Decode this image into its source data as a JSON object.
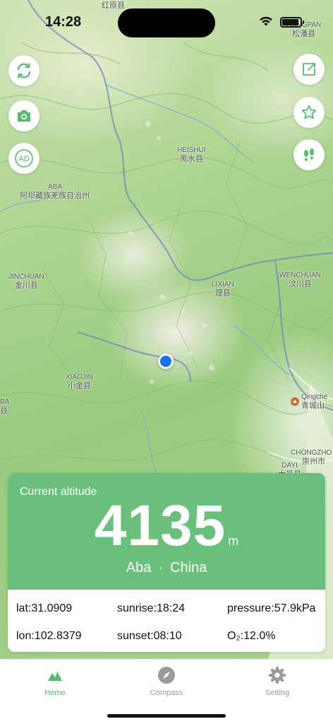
{
  "status_bar": {
    "time": "14:28"
  },
  "map": {
    "labels": {
      "hongyuan": {
        "cn": "红原县"
      },
      "songpan": {
        "en": "SONGPAN",
        "cn": "松潘县"
      },
      "heishui": {
        "en": "HEISHUI",
        "cn": "黑水县"
      },
      "aba_pref": {
        "en": "ABA",
        "cn": "阿坝藏族羌族自治州"
      },
      "jinchuan": {
        "en": "JINCHUAN",
        "cn": "金川县"
      },
      "lixian": {
        "en": "LIXIAN",
        "cn": "理县"
      },
      "wenchuan": {
        "en": "WENCHUAN",
        "cn": "汶川县"
      },
      "xiaojin": {
        "en": "XIAOJIN",
        "cn": "小金县"
      },
      "aba_edge": {
        "en": "BA",
        "cn": "县"
      },
      "qingcheng": {
        "en": "Qingche",
        "cn": "青城山"
      },
      "chongzhou": {
        "en": "CHONGZHO",
        "cn": "崇州市"
      },
      "dayi": {
        "en": "DAYI",
        "cn": "大邑县"
      }
    }
  },
  "buttons": {
    "refresh": "refresh-icon",
    "camera": "camera-icon",
    "ad": "AD",
    "share": "share-icon",
    "favorite": "star-icon",
    "footprints": "footprints-icon"
  },
  "altitude_card": {
    "caption": "Current altitude",
    "value": "4135",
    "unit": "m",
    "region": "Aba",
    "separator": "·",
    "country": "China",
    "lat": "lat:31.0909",
    "lon": "lon:102.8379",
    "sunrise": "sunrise:18:24",
    "sunset": "sunset:08:10",
    "pressure": "pressure:57.9kPa",
    "oxygen": "O₂:12.0%",
    "accent": "#6abf7c"
  },
  "tabbar": {
    "tabs": [
      {
        "label": "Home",
        "icon": "mountain-icon",
        "active": true
      },
      {
        "label": "Compass",
        "icon": "compass-icon",
        "active": false
      },
      {
        "label": "Setting",
        "icon": "gear-icon",
        "active": false
      }
    ],
    "active_color": "#5cb870",
    "inactive_color": "#9a9a9a"
  }
}
